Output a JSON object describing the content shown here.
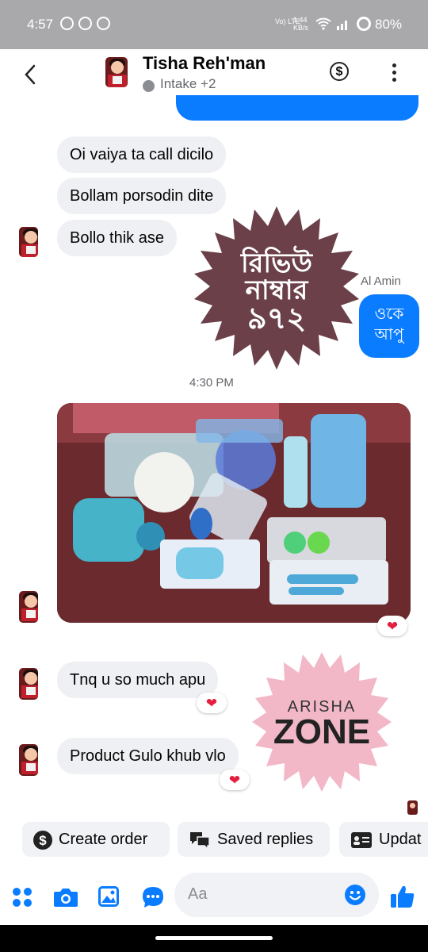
{
  "status_bar": {
    "time": "4:57",
    "network": "Vo) LTE",
    "speed": "1.44 KB/s",
    "battery": "80%"
  },
  "header": {
    "name": "Tisha Reh'man",
    "subtitle": "Intake +2"
  },
  "messages": {
    "m1": "Oi vaiya ta call dicilo",
    "m2": "Bollam porsodin dite",
    "m3": "Bollo thik ase",
    "sender_out": "Al Amin",
    "out_line1": "ওকে",
    "out_line2": "আপু",
    "timestamp": "4:30 PM",
    "m4": "Tnq u so much apu",
    "m5": "Product Gulo khub vlo"
  },
  "reactions": {
    "photo": "❤",
    "m4": "❤",
    "m5": "❤"
  },
  "overlay": {
    "review_line1": "রিভিউ",
    "review_line2": "নাম্বার",
    "review_line3": "৯৭২",
    "zone_top": "ARISHA",
    "zone_bottom": "ZONE"
  },
  "quick_replies": [
    "Create order",
    "Saved replies",
    "Updat"
  ],
  "composer": {
    "placeholder": "Aa"
  },
  "colors": {
    "accent": "#0a7cff",
    "incoming_bubble": "#eef0f3",
    "review_badge": "#6b4049",
    "zone_badge": "#f2b8c8"
  }
}
